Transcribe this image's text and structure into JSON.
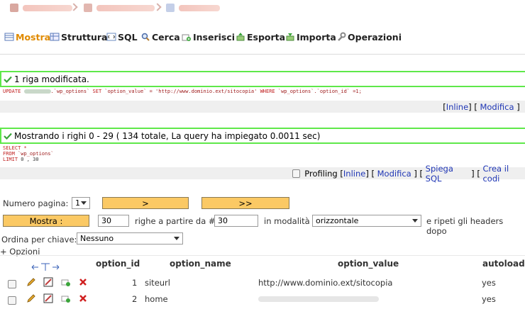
{
  "tabs": [
    {
      "label": "Mostra",
      "icon": "browse-icon"
    },
    {
      "label": "Struttura",
      "icon": "structure-icon"
    },
    {
      "label": "SQL",
      "icon": "sql-icon"
    },
    {
      "label": "Cerca",
      "icon": "search-icon"
    },
    {
      "label": "Inserisci",
      "icon": "insert-icon"
    },
    {
      "label": "Esporta",
      "icon": "export-icon"
    },
    {
      "label": "Importa",
      "icon": "import-icon"
    },
    {
      "label": "Operazioni",
      "icon": "wrench-icon"
    }
  ],
  "update_message": {
    "text": "1 riga modificata.",
    "sql": {
      "kw_update": "UPDATE",
      "table": ".`wp_options`",
      "kw_set": "SET",
      "assign": "`option_value` = 'http://www.dominio.ext/sitocopia'",
      "kw_where": "WHERE",
      "cond": "`wp_options`.`option_id` =1;"
    }
  },
  "update_links": {
    "inline": "Inline",
    "edit": "Modifica"
  },
  "select_message": {
    "text": "Mostrando i righi 0 - 29 ( 134 totale, La query ha impiegato 0.0011 sec)",
    "sql_line1": "SELECT *",
    "sql_line2_kw": "FROM",
    "sql_line2_val": "`wp_options`",
    "sql_line3_kw": "LIMIT",
    "sql_line3_val": "0 , 30"
  },
  "select_links": {
    "profiling": "Profiling",
    "inline": "Inline",
    "edit": "Modifica",
    "explain": "Spiega SQL",
    "create": "Crea il codi"
  },
  "pagination": {
    "page_label": "Numero pagina:",
    "page_value": "1",
    "next": ">",
    "last": ">>",
    "show_button": "Mostra :",
    "rows_value": "30",
    "rows_label": "righe a partire da #",
    "start_value": "30",
    "mode_label": "in modalità",
    "mode_value": "orizzontale",
    "repeat_label": "e ripeti gli headers dopo"
  },
  "sort": {
    "label": "Ordina per chiave:",
    "value": "Nessuno"
  },
  "options_link": "+ Opzioni",
  "table": {
    "columns": [
      "option_id",
      "option_name",
      "option_value",
      "autoload"
    ],
    "rows": [
      {
        "option_id": "1",
        "option_name": "siteurl",
        "option_value": "http://www.dominio.ext/sitocopia",
        "autoload": "yes"
      },
      {
        "option_id": "2",
        "option_name": "home",
        "option_value": "",
        "autoload": "yes"
      }
    ]
  },
  "colors": {
    "accent": "#e08a00",
    "success_border": "#5fe84a",
    "link": "#1f36b5",
    "button": "#fbc964"
  }
}
